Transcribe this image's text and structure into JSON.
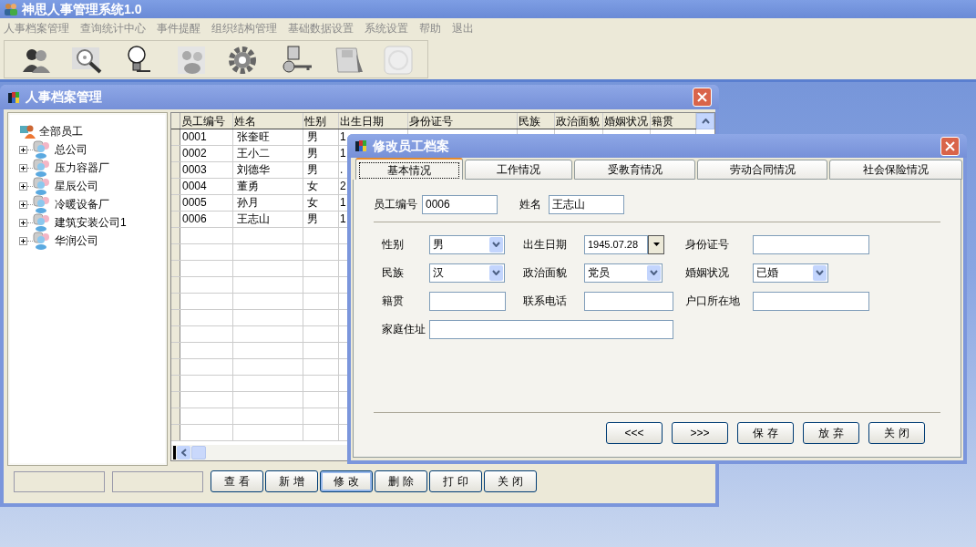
{
  "app": {
    "title": "神思人事管理系统1.0"
  },
  "menu": [
    "人事档案管理",
    "查询统计中心",
    "事件提醒",
    "组织结构管理",
    "基础数据设置",
    "系统设置",
    "帮助",
    "退出"
  ],
  "main_window": {
    "title": "人事档案管理",
    "tree": {
      "label": "全部员工",
      "children": [
        {
          "label": "总公司",
          "expanded": false
        },
        {
          "label": "压力容器厂",
          "expanded": false
        },
        {
          "label": "星辰公司",
          "expanded": false
        },
        {
          "label": "冷暖设备厂",
          "expanded": false
        },
        {
          "label": "建筑安装公司1",
          "expanded": false
        },
        {
          "label": "华润公司",
          "expanded": false
        }
      ]
    },
    "grid": {
      "columns": [
        "员工编号",
        "姓名",
        "性别",
        "出生日期",
        "身份证号",
        "民族",
        "政治面貌",
        "婚姻状况",
        "籍贯"
      ],
      "rows": [
        {
          "cells": [
            "0001",
            "张奎旺",
            "男",
            "1"
          ]
        },
        {
          "cells": [
            "0002",
            "王小二",
            "男",
            "1"
          ]
        },
        {
          "cells": [
            "0003",
            "刘德华",
            "男",
            "."
          ]
        },
        {
          "cells": [
            "0004",
            "董勇",
            "女",
            "2"
          ]
        },
        {
          "cells": [
            "0005",
            "孙月",
            "女",
            "1"
          ]
        },
        {
          "cells": [
            "0006",
            "王志山",
            "男",
            "1"
          ]
        }
      ]
    },
    "buttons": [
      {
        "label": "查 看",
        "focused": false
      },
      {
        "label": "新 增",
        "focused": false
      },
      {
        "label": "修 改",
        "focused": true
      },
      {
        "label": "删 除",
        "focused": false
      },
      {
        "label": "打 印",
        "focused": false
      },
      {
        "label": "关 闭",
        "focused": false
      }
    ]
  },
  "dialog": {
    "title": "修改员工档案",
    "tabs": [
      {
        "label": "基本情况",
        "selected": true
      },
      {
        "label": "工作情况",
        "selected": false
      },
      {
        "label": "受教育情况",
        "selected": false
      },
      {
        "label": "劳动合同情况",
        "selected": false
      },
      {
        "label": "社会保险情况",
        "selected": false
      }
    ],
    "header_fields": [
      {
        "label": "员工编号",
        "kind": "text",
        "value": "0006"
      },
      {
        "label": "姓名",
        "kind": "text",
        "value": "王志山"
      }
    ],
    "rows": [
      [
        {
          "label": "性别",
          "kind": "select",
          "value": "男"
        },
        {
          "label": "出生日期",
          "kind": "date",
          "value": "1945.07.28"
        },
        {
          "label": "身份证号",
          "kind": "text"
        }
      ],
      [
        {
          "label": "民族",
          "kind": "select",
          "value": "汉"
        },
        {
          "label": "政治面貌",
          "kind": "select",
          "value": "党员"
        },
        {
          "label": "婚姻状况",
          "kind": "select",
          "value": "已婚"
        }
      ],
      [
        {
          "label": "籍贯",
          "kind": "text"
        },
        {
          "label": "联系电话",
          "kind": "text"
        },
        {
          "label": "户口所在地",
          "kind": "text"
        }
      ],
      [
        {
          "label": "家庭住址",
          "kind": "text"
        }
      ]
    ],
    "buttons": [
      {
        "label": "<<<",
        "focused": false
      },
      {
        "label": ">>>",
        "focused": false
      },
      {
        "label": "保 存",
        "focused": false
      },
      {
        "label": "放 弃",
        "focused": false
      },
      {
        "label": "关 闭",
        "focused": false
      }
    ]
  }
}
